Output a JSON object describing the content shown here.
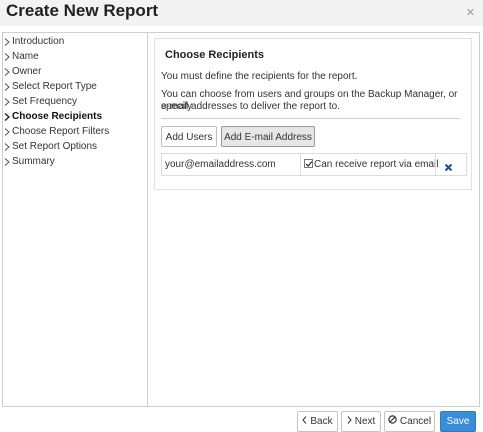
{
  "window": {
    "title": "Create New Report",
    "close_icon": "close-icon"
  },
  "sidebar": {
    "items": [
      {
        "label": "Introduction",
        "active": false
      },
      {
        "label": "Name",
        "active": false
      },
      {
        "label": "Owner",
        "active": false
      },
      {
        "label": "Select Report Type",
        "active": false
      },
      {
        "label": "Set Frequency",
        "active": false
      },
      {
        "label": "Choose Recipients",
        "active": true
      },
      {
        "label": "Choose Report Filters",
        "active": false
      },
      {
        "label": "Set Report Options",
        "active": false
      },
      {
        "label": "Summary",
        "active": false
      }
    ]
  },
  "panel": {
    "title": "Choose Recipients",
    "desc1": "You must define the recipients for the report.",
    "desc2_line1": "You can choose from users and groups on the Backup Manager, or specify",
    "desc2_line2": "e-mail addresses to deliver the report to.",
    "add_users_label": "Add Users",
    "add_email_label": "Add E-mail Address",
    "recipients": [
      {
        "email": "your@emailaddress.com",
        "can_receive_label": "Can receive report via email",
        "checked": true
      }
    ]
  },
  "footer": {
    "back_label": "Back",
    "next_label": "Next",
    "cancel_label": "Cancel",
    "save_label": "Save"
  },
  "colors": {
    "accent": "#3a8dd6",
    "remove_icon": "#1f4e99"
  }
}
